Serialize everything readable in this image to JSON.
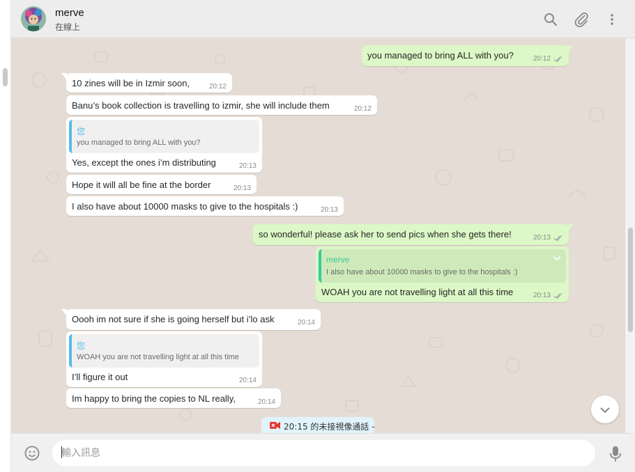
{
  "header": {
    "contact_name": "merve",
    "status": "在線上"
  },
  "messages": [
    {
      "dir": "out",
      "text": "you managed to bring ALL with you?",
      "time": "20:12"
    },
    {
      "dir": "in",
      "text": "10 zines will be in Izmir soon,",
      "time": "20:12"
    },
    {
      "dir": "in",
      "text": "Banu’s book collection is travelling to izmir, she will include them",
      "time": "20:12"
    },
    {
      "dir": "in",
      "quote_name": "您",
      "quote_text": "you managed to bring ALL with you?",
      "text": "Yes, except the ones i’m distributing",
      "time": "20:13"
    },
    {
      "dir": "in",
      "text": "Hope it will all be fine at the border",
      "time": "20:13"
    },
    {
      "dir": "in",
      "text": "I also have about 10000 masks to give to the hospitals :)",
      "time": "20:13"
    },
    {
      "dir": "out",
      "text": "so wonderful! please ask her to send pics when she gets there!",
      "time": "20:13"
    },
    {
      "dir": "out",
      "quote_name": "merve",
      "quote_text": "I also have about 10000 masks to give to the hospitals :)",
      "text": "WOAH you are not travelling light at all this time",
      "time": "20:13"
    },
    {
      "dir": "in",
      "text": "Oooh im not sure if she is going herself but i’lo ask",
      "time": "20:14"
    },
    {
      "dir": "in",
      "quote_name": "您",
      "quote_text": "WOAH you are not travelling light at all this time",
      "text": "I’ll figure it out",
      "time": "20:14"
    },
    {
      "dir": "in",
      "text": "Im happy to bring the copies to NL really,",
      "time": "20:14"
    }
  ],
  "missed_call": {
    "text": "20:15 的未接視像通話 -",
    "icon": "missed-video-call-icon"
  },
  "composer": {
    "placeholder": "輸入訊息"
  },
  "icons": {
    "search": "search-icon",
    "attach": "paperclip-icon",
    "menu": "more-vertical-icon",
    "emoji": "emoji-icon",
    "mic": "microphone-icon",
    "scroll_down": "chevron-down-icon"
  },
  "colors": {
    "chat_bg": "#e5ddd5",
    "outgoing_bubble": "#dcf8c6",
    "incoming_bubble": "#ffffff",
    "quote_mine": "#53bdeb",
    "quote_contact": "#35cd96",
    "missed_call_red": "#e53935"
  }
}
